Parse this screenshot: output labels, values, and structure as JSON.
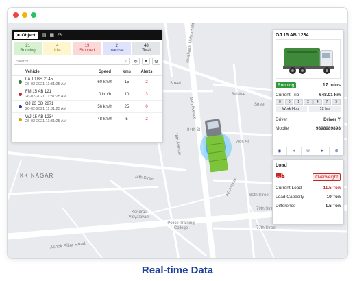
{
  "window": {
    "dots": [
      "#ef4444",
      "#f5b400",
      "#22c55e"
    ]
  },
  "map": {
    "labels": {
      "kk_nagar": "KK NAGAR",
      "ashok_pillar": "Ashok Pillar Road",
      "3rd_ave": "3rd Ave",
      "84th_st": "84th St",
      "78th_st": "78th St",
      "street_top": "Street",
      "street_right1": "Street",
      "jawaharlal": "Jawaharlal Nehru Salai",
      "19th_ave": "19th Avenue",
      "18th_ave": "18th Avenue",
      "74th_st": "74th Street",
      "4th_ave": "4th Avenue",
      "80th_st": "80th Street",
      "79th_st": "79th Street",
      "77th_st": "77th Street",
      "kendras": "Kendras Vidyalayam",
      "police_college": "Police Training College"
    }
  },
  "left_panel": {
    "tab_label": "Object",
    "tab_icon": "navigation-arrow-icon",
    "header_icons": [
      "building-icon",
      "grid-icon",
      "user-icon"
    ],
    "stats": [
      {
        "count": "21",
        "label": "Running",
        "bg": "#d9f0d3",
        "color": "#2e7d32"
      },
      {
        "count": "4",
        "label": "Idle",
        "bg": "#fdf6cf",
        "color": "#a17a00"
      },
      {
        "count": "19",
        "label": "Stopped",
        "bg": "#fbd9d9",
        "color": "#c62828"
      },
      {
        "count": "2",
        "label": "Inactive",
        "bg": "#dfe4fb",
        "color": "#283593"
      },
      {
        "count": "48",
        "label": "Total",
        "bg": "#e4e5e8",
        "color": "#222222"
      }
    ],
    "search_placeholder": "Search",
    "table_headers": {
      "vehicle": "Vehicle",
      "speed": "Speed",
      "kms": "kms",
      "alerts": "Alerts"
    },
    "rows": [
      {
        "name": "LA 10 BS 2145",
        "time": "26-02-2021 11:31:25 AM",
        "speed": "60 km/h",
        "kms": "15",
        "alerts": "2",
        "dot": "#2e7d32"
      },
      {
        "name": "FM 15 AB 121",
        "time": "26-02-2021 11:31:25 AM",
        "speed": "0 km/h",
        "kms": "10",
        "alerts": "3",
        "dot": "#c62828"
      },
      {
        "name": "OJ 23 CD 2871",
        "time": "26-02-2021 11:31:25 AM",
        "speed": "56 km/h",
        "kms": "25",
        "alerts": "0",
        "dot": "#283593"
      },
      {
        "name": "WJ 15 AB 1234",
        "time": "26-02-2021 11:31:25 AM",
        "speed": "48 km/h",
        "kms": "5",
        "alerts": "2",
        "dot": "#d4a000"
      }
    ]
  },
  "vehicle_panel": {
    "plate": "GJ 15 AB 1234",
    "status": "Running",
    "duration": "17 mins",
    "current_trip_label": "Current Trip",
    "current_trip_value": "648.01 km",
    "odometer": [
      "0",
      "0",
      "1",
      "2",
      "4",
      "7",
      "9"
    ],
    "work_hour_label": "Work Hour",
    "work_hour_value": "12 hrs",
    "driver_label": "Driver",
    "driver_value": "Driver Y",
    "mobile_label": "Mobile",
    "mobile_value": "9898989898",
    "action_icons": [
      "eye-icon",
      "share-icon",
      "user-icon",
      "navigate-icon",
      "zoom-icon"
    ]
  },
  "load_panel": {
    "title": "Load",
    "badge": "Overweight",
    "current_load_label": "Current Load",
    "current_load_value": "11.5 Ton",
    "capacity_label": "Load Capacity",
    "capacity_value": "10 Ton",
    "difference_label": "Difference",
    "difference_value": "1.5 Ton"
  },
  "caption": "Real-time Data"
}
